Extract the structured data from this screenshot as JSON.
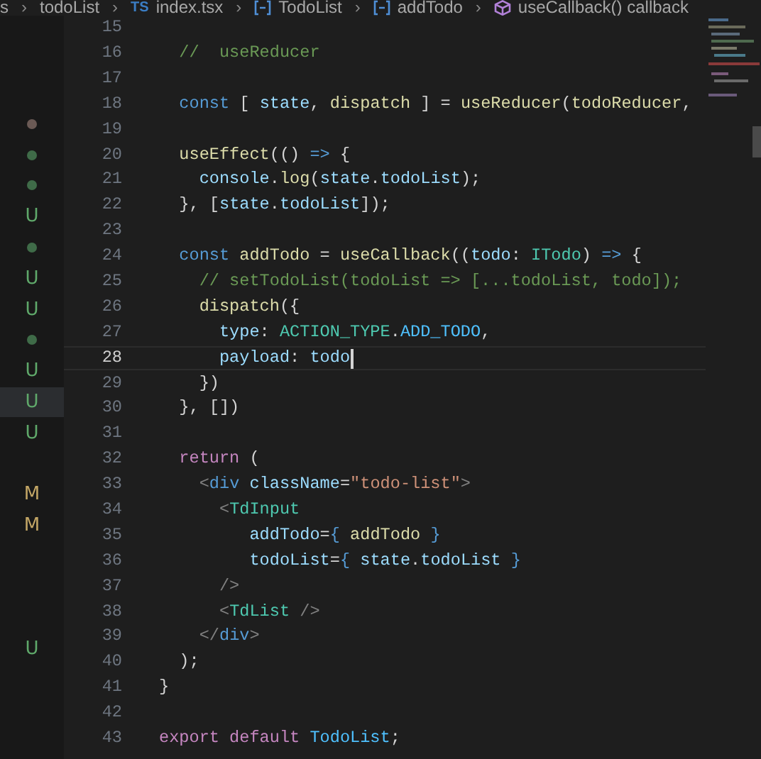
{
  "breadcrumb": [
    {
      "text": "s",
      "kind": "folder"
    },
    {
      "separator": "›",
      "text": "todoList",
      "kind": "folder"
    },
    {
      "separator": "›",
      "text": "index.tsx",
      "kind": "file",
      "badge": "TS"
    },
    {
      "separator": "›",
      "text": "TodoList",
      "kind": "symbol"
    },
    {
      "separator": "›",
      "text": "addTodo",
      "kind": "symbol"
    },
    {
      "separator": "›",
      "text": "useCallback() callback",
      "kind": "method"
    }
  ],
  "explorer_decorations": [
    {
      "kind": "none",
      "selected": false
    },
    {
      "kind": "none",
      "selected": false
    },
    {
      "kind": "none",
      "selected": false
    },
    {
      "kind": "dot",
      "color": "#6b5a55",
      "selected": false
    },
    {
      "kind": "dot",
      "color": "#3f6b48",
      "selected": false
    },
    {
      "kind": "dot",
      "color": "#3f6b48",
      "selected": false
    },
    {
      "kind": "letter",
      "text": "U",
      "color": "#5fa86a",
      "selected": false
    },
    {
      "kind": "dot",
      "color": "#3f6b48",
      "selected": false
    },
    {
      "kind": "letter",
      "text": "U",
      "color": "#5fa86a",
      "selected": false
    },
    {
      "kind": "letter",
      "text": "U",
      "color": "#5fa86a",
      "selected": false
    },
    {
      "kind": "dot",
      "color": "#3f6b48",
      "selected": false
    },
    {
      "kind": "letter",
      "text": "U",
      "color": "#5fa86a",
      "selected": false
    },
    {
      "kind": "letter",
      "text": "U",
      "color": "#5fa86a",
      "selected": true
    },
    {
      "kind": "letter",
      "text": "U",
      "color": "#5fa86a",
      "selected": false
    },
    {
      "kind": "none",
      "selected": false
    },
    {
      "kind": "letter",
      "text": "M",
      "color": "#c4a766",
      "selected": false
    },
    {
      "kind": "letter",
      "text": "M",
      "color": "#c4a766",
      "selected": false
    },
    {
      "kind": "none",
      "selected": false
    },
    {
      "kind": "none",
      "selected": false
    },
    {
      "kind": "none",
      "selected": false
    },
    {
      "kind": "letter",
      "text": "U",
      "color": "#5fa86a",
      "selected": false
    }
  ],
  "editor": {
    "lines": [
      {
        "number": "15",
        "current": false
      },
      {
        "number": "16",
        "current": false,
        "tokens": [
          {
            "kind": "comment",
            "text": "  //  useReducer"
          }
        ]
      },
      {
        "number": "17",
        "current": false
      },
      {
        "number": "18",
        "current": false,
        "tokens": [
          {
            "kind": "keyword",
            "text": "  const"
          },
          {
            "kind": "plain",
            "text": " [ "
          },
          {
            "kind": "variable",
            "text": "state"
          },
          {
            "kind": "plain",
            "text": ", "
          },
          {
            "kind": "function",
            "text": "dispatch"
          },
          {
            "kind": "plain",
            "text": " ] = "
          },
          {
            "kind": "function",
            "text": "useReducer"
          },
          {
            "kind": "plain",
            "text": "("
          },
          {
            "kind": "function",
            "text": "todoReducer"
          },
          {
            "kind": "plain",
            "text": ","
          }
        ]
      },
      {
        "number": "19",
        "current": false
      },
      {
        "number": "20",
        "current": false,
        "tokens": [
          {
            "kind": "function",
            "text": "  useEffect"
          },
          {
            "kind": "plain",
            "text": "(() "
          },
          {
            "kind": "keyword",
            "text": "=>"
          },
          {
            "kind": "plain",
            "text": " {"
          }
        ]
      },
      {
        "number": "21",
        "current": false,
        "tokens": [
          {
            "kind": "variable",
            "text": "    console"
          },
          {
            "kind": "plain",
            "text": "."
          },
          {
            "kind": "function",
            "text": "log"
          },
          {
            "kind": "plain",
            "text": "("
          },
          {
            "kind": "variable",
            "text": "state"
          },
          {
            "kind": "plain",
            "text": "."
          },
          {
            "kind": "variable",
            "text": "todoList"
          },
          {
            "kind": "plain",
            "text": ");"
          }
        ]
      },
      {
        "number": "22",
        "current": false,
        "tokens": [
          {
            "kind": "plain",
            "text": "  }, ["
          },
          {
            "kind": "variable",
            "text": "state"
          },
          {
            "kind": "plain",
            "text": "."
          },
          {
            "kind": "variable",
            "text": "todoList"
          },
          {
            "kind": "plain",
            "text": "]);"
          }
        ]
      },
      {
        "number": "23",
        "current": false
      },
      {
        "number": "24",
        "current": false,
        "tokens": [
          {
            "kind": "keyword",
            "text": "  const "
          },
          {
            "kind": "function",
            "text": "addTodo"
          },
          {
            "kind": "plain",
            "text": " = "
          },
          {
            "kind": "function",
            "text": "useCallback"
          },
          {
            "kind": "plain",
            "text": "(("
          },
          {
            "kind": "variable",
            "text": "todo"
          },
          {
            "kind": "plain",
            "text": ": "
          },
          {
            "kind": "type",
            "text": "ITodo"
          },
          {
            "kind": "plain",
            "text": ") "
          },
          {
            "kind": "keyword",
            "text": "=>"
          },
          {
            "kind": "plain",
            "text": " {"
          }
        ]
      },
      {
        "number": "25",
        "current": false,
        "tokens": [
          {
            "kind": "comment",
            "text": "    // setTodoList(todoList => [...todoList, todo]);"
          }
        ]
      },
      {
        "number": "26",
        "current": false,
        "tokens": [
          {
            "kind": "function",
            "text": "    dispatch"
          },
          {
            "kind": "plain",
            "text": "({"
          }
        ]
      },
      {
        "number": "27",
        "current": false,
        "tokens": [
          {
            "kind": "variable",
            "text": "      type"
          },
          {
            "kind": "plain",
            "text": ": "
          },
          {
            "kind": "type",
            "text": "ACTION_TYPE"
          },
          {
            "kind": "plain",
            "text": "."
          },
          {
            "kind": "constant",
            "text": "ADD_TODO"
          },
          {
            "kind": "plain",
            "text": ","
          }
        ]
      },
      {
        "number": "28",
        "current": true,
        "tokens": [
          {
            "kind": "variable",
            "text": "      payload"
          },
          {
            "kind": "plain",
            "text": ": "
          },
          {
            "kind": "variable",
            "text": "todo"
          }
        ]
      },
      {
        "number": "29",
        "current": false,
        "tokens": [
          {
            "kind": "plain",
            "text": "    })"
          }
        ]
      },
      {
        "number": "30",
        "current": false,
        "tokens": [
          {
            "kind": "plain",
            "text": "  }, [])"
          }
        ]
      },
      {
        "number": "31",
        "current": false
      },
      {
        "number": "32",
        "current": false,
        "tokens": [
          {
            "kind": "control",
            "text": "  return"
          },
          {
            "kind": "plain",
            "text": " ("
          }
        ]
      },
      {
        "number": "33",
        "current": false,
        "tokens": [
          {
            "kind": "punctuation",
            "text": "    <"
          },
          {
            "kind": "keyword",
            "text": "div"
          },
          {
            "kind": "variable",
            "text": " className"
          },
          {
            "kind": "plain",
            "text": "="
          },
          {
            "kind": "string",
            "text": "\"todo-list\""
          },
          {
            "kind": "punctuation",
            "text": ">"
          }
        ]
      },
      {
        "number": "34",
        "current": false,
        "tokens": [
          {
            "kind": "punctuation",
            "text": "      <"
          },
          {
            "kind": "type",
            "text": "TdInput"
          }
        ]
      },
      {
        "number": "35",
        "current": false,
        "tokens": [
          {
            "kind": "variable",
            "text": "         addTodo"
          },
          {
            "kind": "plain",
            "text": "="
          },
          {
            "kind": "keyword",
            "text": "{"
          },
          {
            "kind": "function",
            "text": " addTodo"
          },
          {
            "kind": "keyword",
            "text": " }"
          }
        ]
      },
      {
        "number": "36",
        "current": false,
        "tokens": [
          {
            "kind": "variable",
            "text": "         todoList"
          },
          {
            "kind": "plain",
            "text": "="
          },
          {
            "kind": "keyword",
            "text": "{"
          },
          {
            "kind": "variable",
            "text": " state"
          },
          {
            "kind": "plain",
            "text": "."
          },
          {
            "kind": "variable",
            "text": "todoList"
          },
          {
            "kind": "keyword",
            "text": " }"
          }
        ]
      },
      {
        "number": "37",
        "current": false,
        "tokens": [
          {
            "kind": "punctuation",
            "text": "      />"
          }
        ]
      },
      {
        "number": "38",
        "current": false,
        "tokens": [
          {
            "kind": "punctuation",
            "text": "      <"
          },
          {
            "kind": "type",
            "text": "TdList"
          },
          {
            "kind": "punctuation",
            "text": " />"
          }
        ]
      },
      {
        "number": "39",
        "current": false,
        "tokens": [
          {
            "kind": "punctuation",
            "text": "    </"
          },
          {
            "kind": "keyword",
            "text": "div"
          },
          {
            "kind": "punctuation",
            "text": ">"
          }
        ]
      },
      {
        "number": "40",
        "current": false,
        "tokens": [
          {
            "kind": "plain",
            "text": "  );"
          }
        ]
      },
      {
        "number": "41",
        "current": false,
        "tokens": [
          {
            "kind": "plain",
            "text": "}"
          }
        ]
      },
      {
        "number": "42",
        "current": false
      },
      {
        "number": "43",
        "current": false,
        "tokens": [
          {
            "kind": "control",
            "text": "export default"
          },
          {
            "kind": "constant",
            "text": " TodoList"
          },
          {
            "kind": "plain",
            "text": ";"
          }
        ]
      }
    ]
  }
}
